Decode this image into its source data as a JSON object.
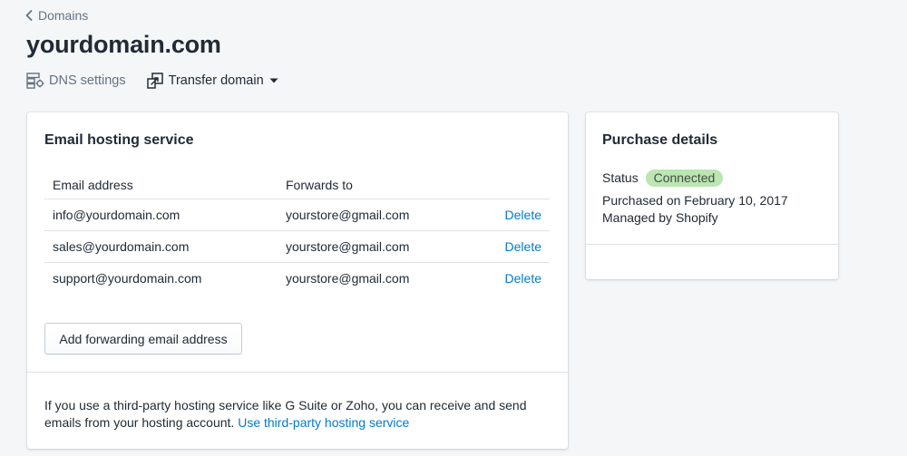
{
  "breadcrumb": {
    "label": "Domains"
  },
  "page": {
    "title": "yourdomain.com"
  },
  "actions": {
    "dns_label": "DNS settings",
    "transfer_label": "Transfer domain"
  },
  "email_card": {
    "title": "Email hosting service",
    "columns": [
      "Email address",
      "Forwards to"
    ],
    "rows": [
      {
        "email": "info@yourdomain.com",
        "forwards_to": "yourstore@gmail.com",
        "action": "Delete"
      },
      {
        "email": "sales@yourdomain.com",
        "forwards_to": "yourstore@gmail.com",
        "action": "Delete"
      },
      {
        "email": "support@yourdomain.com",
        "forwards_to": "yourstore@gmail.com",
        "action": "Delete"
      }
    ],
    "add_button": "Add forwarding email address",
    "footer_text": "If you use a third-party hosting service like G Suite or Zoho, you can receive and send emails from your hosting account.",
    "footer_link": "Use third-party hosting service"
  },
  "purchase_card": {
    "title": "Purchase details",
    "status_label": "Status",
    "status_badge": "Connected",
    "purchased": "Purchased on February 10, 2017",
    "managed": "Managed by Shopify"
  },
  "icons": {
    "back": "chevron-left-icon",
    "dns": "dns-settings-icon",
    "transfer": "transfer-icon",
    "dropdown": "caret-down-icon"
  },
  "colors": {
    "link": "#007ace",
    "badge_bg": "#bbe5b3",
    "page_bg": "#f4f6f8"
  }
}
